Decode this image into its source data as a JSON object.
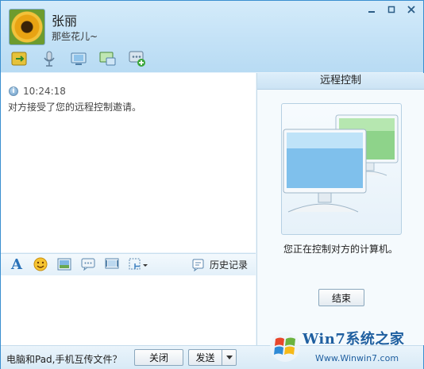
{
  "contact": {
    "name": "张丽",
    "signature": "那些花儿~"
  },
  "window_controls": [
    "minimize-icon",
    "maximize-icon",
    "close-icon"
  ],
  "toolbar": {
    "icons": [
      "file-transfer-icon",
      "voice-icon",
      "video-icon",
      "remote-desktop-icon",
      "more-apps-icon"
    ]
  },
  "chat": {
    "time": "10:24:18",
    "message": "对方接受了您的远程控制邀请。"
  },
  "format_bar": {
    "icons": [
      "font-icon",
      "emoji-icon",
      "image-icon",
      "bubble-icon",
      "screen-icon",
      "screenshot-icon"
    ],
    "history_label": "历史记录"
  },
  "bottom": {
    "prompt": "电脑和Pad,手机互传文件？",
    "close_label": "关闭",
    "send_label": "发送"
  },
  "panel": {
    "title": "远程控制",
    "status": "您正在控制对方的计算机。",
    "end_label": "结束"
  },
  "watermark": {
    "brand": "Win7系统之家",
    "url": "Www.Winwin7.com"
  },
  "colors": {
    "header_bg": "#c2e1f6",
    "border": "#3a8fd0",
    "green_monitor": "#8ed38a",
    "blue_monitor": "#7fc0ec"
  }
}
